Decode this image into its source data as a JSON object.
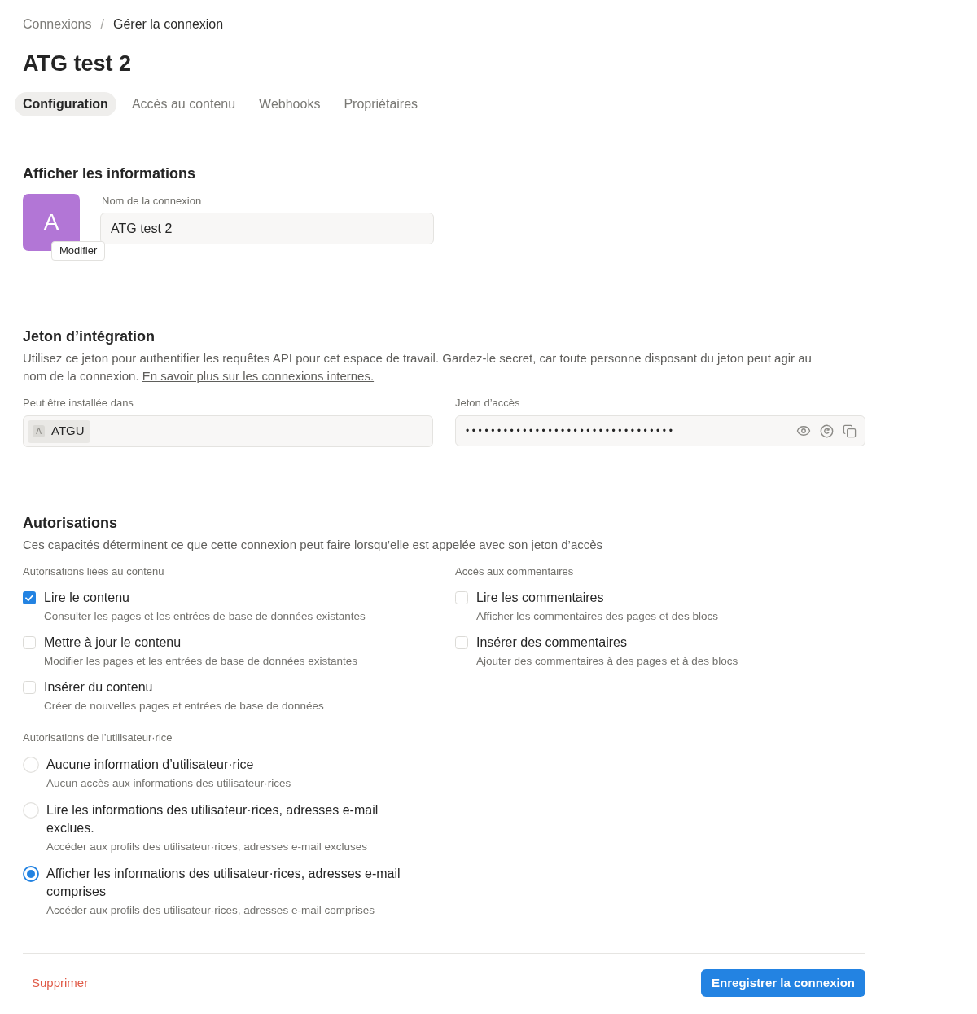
{
  "breadcrumb": {
    "separator": "/",
    "items": [
      {
        "label": "Connexions",
        "current": false
      },
      {
        "label": "Gérer la connexion",
        "current": true
      }
    ]
  },
  "title": "ATG test 2",
  "tabs": [
    {
      "label": "Configuration",
      "selected": true
    },
    {
      "label": "Accès au contenu",
      "selected": false
    },
    {
      "label": "Webhooks",
      "selected": false
    },
    {
      "label": "Propriétaires",
      "selected": false
    }
  ],
  "display": {
    "heading": "Afficher les informations",
    "avatar_letter": "A",
    "edit_button": "Modifier",
    "name_field": {
      "label": "Nom de la connexion",
      "value": "ATG test 2"
    }
  },
  "token": {
    "heading": "Jeton d’intégration",
    "description": "Utilisez ce jeton pour authentifier les requêtes API pour cet espace de travail. Gardez-le secret, car toute personne disposant du jeton peut agir au nom de la connexion.",
    "link": "En savoir plus sur les connexions internes.",
    "workspace_field": {
      "label": "Peut être installée dans",
      "chip_letter": "A",
      "chip_label": "ATGU"
    },
    "token_field": {
      "label": "Jeton d’accès",
      "value": "•••••••••••••••••••••••••••••••••"
    }
  },
  "permissions": {
    "heading": "Autorisations",
    "description": "Ces capacités déterminent ce que cette connexion peut faire lorsqu’elle est appelée avec son jeton d’accès",
    "groups": [
      {
        "label": "Autorisations liées au contenu",
        "options": [
          {
            "title": "Lire le contenu",
            "description": "Consulter les pages et les entrées de base de données existantes",
            "checked": true
          },
          {
            "title": "Mettre à jour le contenu",
            "description": "Modifier les pages et les entrées de base de données existantes",
            "checked": false
          },
          {
            "title": "Insérer du contenu",
            "description": "Créer de nouvelles pages et entrées de base de données",
            "checked": false
          }
        ]
      },
      {
        "label": "Accès aux commentaires",
        "options": [
          {
            "title": "Lire les commentaires",
            "description": "Afficher les commentaires des pages et des blocs",
            "checked": false
          },
          {
            "title": "Insérer des commentaires",
            "description": "Ajouter des commentaires à des pages et à des blocs",
            "checked": false
          }
        ]
      }
    ],
    "user_group": {
      "label": "Autorisations de l’utilisateur·rice",
      "options": [
        {
          "title": "Aucune information d’utilisateur·rice",
          "description": "Aucun accès aux informations des utilisateur·rices",
          "selected": false
        },
        {
          "title": "Lire les informations des utilisateur·rices, adresses e-mail exclues.",
          "description": "Accéder aux profils des utilisateur·rices, adresses e-mail excluses",
          "selected": false
        },
        {
          "title": "Afficher les informations des utilisateur·rices, adresses e-mail comprises",
          "description": "Accéder aux profils des utilisateur·rices, adresses e-mail comprises",
          "selected": true
        }
      ]
    }
  },
  "footer": {
    "delete_button": "Supprimer",
    "save_button": "Enregistrer la connexion"
  }
}
